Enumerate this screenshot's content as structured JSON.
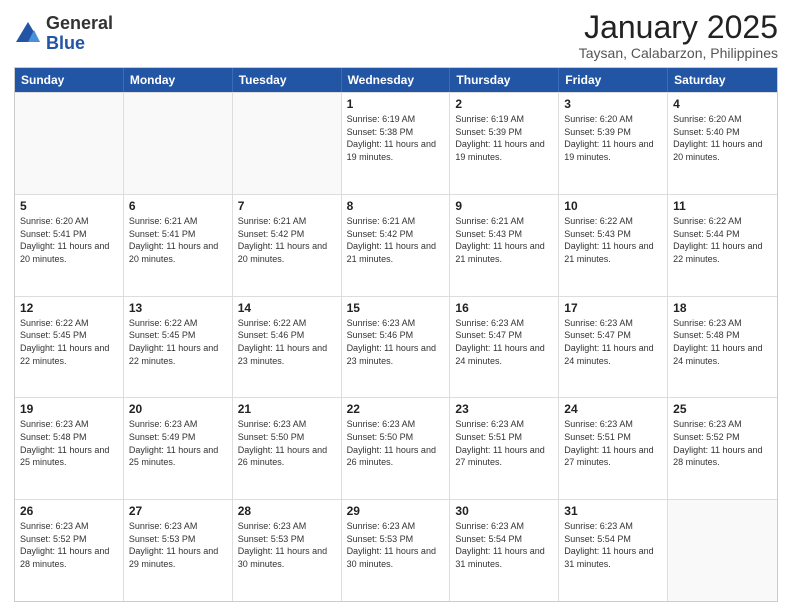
{
  "logo": {
    "general": "General",
    "blue": "Blue"
  },
  "title": "January 2025",
  "subtitle": "Taysan, Calabarzon, Philippines",
  "header_days": [
    "Sunday",
    "Monday",
    "Tuesday",
    "Wednesday",
    "Thursday",
    "Friday",
    "Saturday"
  ],
  "weeks": [
    [
      {
        "day": "",
        "sunrise": "",
        "sunset": "",
        "daylight": "",
        "empty": true
      },
      {
        "day": "",
        "sunrise": "",
        "sunset": "",
        "daylight": "",
        "empty": true
      },
      {
        "day": "",
        "sunrise": "",
        "sunset": "",
        "daylight": "",
        "empty": true
      },
      {
        "day": "1",
        "sunrise": "Sunrise: 6:19 AM",
        "sunset": "Sunset: 5:38 PM",
        "daylight": "Daylight: 11 hours and 19 minutes.",
        "empty": false
      },
      {
        "day": "2",
        "sunrise": "Sunrise: 6:19 AM",
        "sunset": "Sunset: 5:39 PM",
        "daylight": "Daylight: 11 hours and 19 minutes.",
        "empty": false
      },
      {
        "day": "3",
        "sunrise": "Sunrise: 6:20 AM",
        "sunset": "Sunset: 5:39 PM",
        "daylight": "Daylight: 11 hours and 19 minutes.",
        "empty": false
      },
      {
        "day": "4",
        "sunrise": "Sunrise: 6:20 AM",
        "sunset": "Sunset: 5:40 PM",
        "daylight": "Daylight: 11 hours and 20 minutes.",
        "empty": false
      }
    ],
    [
      {
        "day": "5",
        "sunrise": "Sunrise: 6:20 AM",
        "sunset": "Sunset: 5:41 PM",
        "daylight": "Daylight: 11 hours and 20 minutes.",
        "empty": false
      },
      {
        "day": "6",
        "sunrise": "Sunrise: 6:21 AM",
        "sunset": "Sunset: 5:41 PM",
        "daylight": "Daylight: 11 hours and 20 minutes.",
        "empty": false
      },
      {
        "day": "7",
        "sunrise": "Sunrise: 6:21 AM",
        "sunset": "Sunset: 5:42 PM",
        "daylight": "Daylight: 11 hours and 20 minutes.",
        "empty": false
      },
      {
        "day": "8",
        "sunrise": "Sunrise: 6:21 AM",
        "sunset": "Sunset: 5:42 PM",
        "daylight": "Daylight: 11 hours and 21 minutes.",
        "empty": false
      },
      {
        "day": "9",
        "sunrise": "Sunrise: 6:21 AM",
        "sunset": "Sunset: 5:43 PM",
        "daylight": "Daylight: 11 hours and 21 minutes.",
        "empty": false
      },
      {
        "day": "10",
        "sunrise": "Sunrise: 6:22 AM",
        "sunset": "Sunset: 5:43 PM",
        "daylight": "Daylight: 11 hours and 21 minutes.",
        "empty": false
      },
      {
        "day": "11",
        "sunrise": "Sunrise: 6:22 AM",
        "sunset": "Sunset: 5:44 PM",
        "daylight": "Daylight: 11 hours and 22 minutes.",
        "empty": false
      }
    ],
    [
      {
        "day": "12",
        "sunrise": "Sunrise: 6:22 AM",
        "sunset": "Sunset: 5:45 PM",
        "daylight": "Daylight: 11 hours and 22 minutes.",
        "empty": false
      },
      {
        "day": "13",
        "sunrise": "Sunrise: 6:22 AM",
        "sunset": "Sunset: 5:45 PM",
        "daylight": "Daylight: 11 hours and 22 minutes.",
        "empty": false
      },
      {
        "day": "14",
        "sunrise": "Sunrise: 6:22 AM",
        "sunset": "Sunset: 5:46 PM",
        "daylight": "Daylight: 11 hours and 23 minutes.",
        "empty": false
      },
      {
        "day": "15",
        "sunrise": "Sunrise: 6:23 AM",
        "sunset": "Sunset: 5:46 PM",
        "daylight": "Daylight: 11 hours and 23 minutes.",
        "empty": false
      },
      {
        "day": "16",
        "sunrise": "Sunrise: 6:23 AM",
        "sunset": "Sunset: 5:47 PM",
        "daylight": "Daylight: 11 hours and 24 minutes.",
        "empty": false
      },
      {
        "day": "17",
        "sunrise": "Sunrise: 6:23 AM",
        "sunset": "Sunset: 5:47 PM",
        "daylight": "Daylight: 11 hours and 24 minutes.",
        "empty": false
      },
      {
        "day": "18",
        "sunrise": "Sunrise: 6:23 AM",
        "sunset": "Sunset: 5:48 PM",
        "daylight": "Daylight: 11 hours and 24 minutes.",
        "empty": false
      }
    ],
    [
      {
        "day": "19",
        "sunrise": "Sunrise: 6:23 AM",
        "sunset": "Sunset: 5:48 PM",
        "daylight": "Daylight: 11 hours and 25 minutes.",
        "empty": false
      },
      {
        "day": "20",
        "sunrise": "Sunrise: 6:23 AM",
        "sunset": "Sunset: 5:49 PM",
        "daylight": "Daylight: 11 hours and 25 minutes.",
        "empty": false
      },
      {
        "day": "21",
        "sunrise": "Sunrise: 6:23 AM",
        "sunset": "Sunset: 5:50 PM",
        "daylight": "Daylight: 11 hours and 26 minutes.",
        "empty": false
      },
      {
        "day": "22",
        "sunrise": "Sunrise: 6:23 AM",
        "sunset": "Sunset: 5:50 PM",
        "daylight": "Daylight: 11 hours and 26 minutes.",
        "empty": false
      },
      {
        "day": "23",
        "sunrise": "Sunrise: 6:23 AM",
        "sunset": "Sunset: 5:51 PM",
        "daylight": "Daylight: 11 hours and 27 minutes.",
        "empty": false
      },
      {
        "day": "24",
        "sunrise": "Sunrise: 6:23 AM",
        "sunset": "Sunset: 5:51 PM",
        "daylight": "Daylight: 11 hours and 27 minutes.",
        "empty": false
      },
      {
        "day": "25",
        "sunrise": "Sunrise: 6:23 AM",
        "sunset": "Sunset: 5:52 PM",
        "daylight": "Daylight: 11 hours and 28 minutes.",
        "empty": false
      }
    ],
    [
      {
        "day": "26",
        "sunrise": "Sunrise: 6:23 AM",
        "sunset": "Sunset: 5:52 PM",
        "daylight": "Daylight: 11 hours and 28 minutes.",
        "empty": false
      },
      {
        "day": "27",
        "sunrise": "Sunrise: 6:23 AM",
        "sunset": "Sunset: 5:53 PM",
        "daylight": "Daylight: 11 hours and 29 minutes.",
        "empty": false
      },
      {
        "day": "28",
        "sunrise": "Sunrise: 6:23 AM",
        "sunset": "Sunset: 5:53 PM",
        "daylight": "Daylight: 11 hours and 30 minutes.",
        "empty": false
      },
      {
        "day": "29",
        "sunrise": "Sunrise: 6:23 AM",
        "sunset": "Sunset: 5:53 PM",
        "daylight": "Daylight: 11 hours and 30 minutes.",
        "empty": false
      },
      {
        "day": "30",
        "sunrise": "Sunrise: 6:23 AM",
        "sunset": "Sunset: 5:54 PM",
        "daylight": "Daylight: 11 hours and 31 minutes.",
        "empty": false
      },
      {
        "day": "31",
        "sunrise": "Sunrise: 6:23 AM",
        "sunset": "Sunset: 5:54 PM",
        "daylight": "Daylight: 11 hours and 31 minutes.",
        "empty": false
      },
      {
        "day": "",
        "sunrise": "",
        "sunset": "",
        "daylight": "",
        "empty": true
      }
    ]
  ]
}
